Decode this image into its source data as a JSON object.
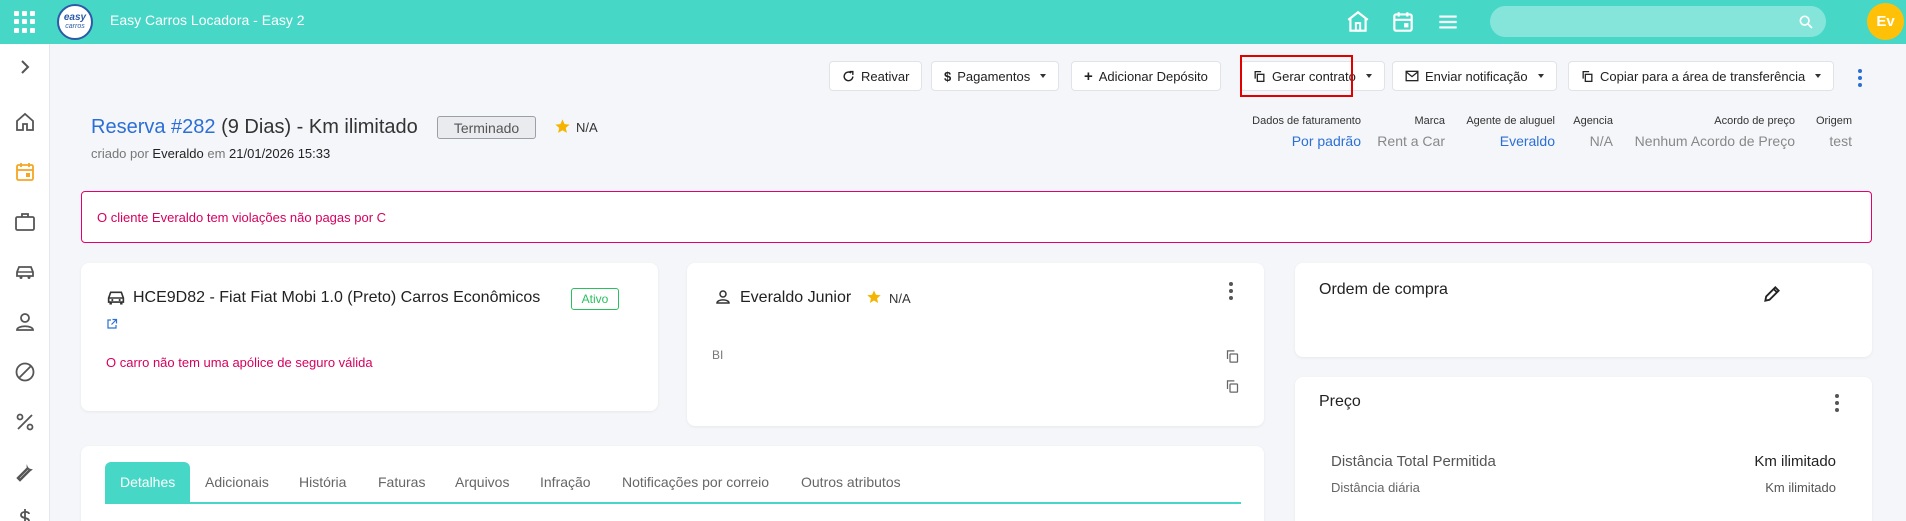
{
  "header": {
    "app_title": "Easy Carros Locadora - Easy 2",
    "logo_line1": "easy",
    "logo_line2": "carros",
    "avatar_initials": "Ev",
    "search_placeholder": ""
  },
  "toolbar": {
    "reactivate": "Reativar",
    "payments": "Pagamentos",
    "add_deposit": "Adicionar Depósito",
    "generate_contract": "Gerar contrato",
    "send_notification": "Enviar notificação",
    "copy_clipboard": "Copiar para a área de transferência"
  },
  "reservation": {
    "title_link": "Reserva #282",
    "title_rest": " (9 Dias) - Km ilimitado",
    "status": "Terminado",
    "rating": "N/A",
    "created_prefix": "criado por ",
    "created_by": "Everaldo",
    "created_mid": " em ",
    "created_at": "21/01/2026 15:33"
  },
  "meta": [
    {
      "label": "Dados de faturamento",
      "value": "Por padrão",
      "link": true
    },
    {
      "label": "Marca",
      "value": "Rent a Car",
      "link": false
    },
    {
      "label": "Agente de aluguel",
      "value": "Everaldo",
      "link": true
    },
    {
      "label": "Agencia",
      "value": "N/A",
      "link": false
    },
    {
      "label": "Acordo de preço",
      "value": "Nenhum Acordo de Preço",
      "link": false
    },
    {
      "label": "Origem",
      "value": "test",
      "link": false
    }
  ],
  "alert": "O cliente Everaldo tem violações não pagas por C",
  "vehicle": {
    "title": "HCE9D82 - Fiat Fiat Mobi 1.0 (Preto) Carros Econômicos",
    "status": "Ativo",
    "warning": "O carro não tem uma apólice de seguro válida"
  },
  "customer": {
    "name": "Everaldo Junior",
    "rating": "N/A",
    "doc_label": "BI"
  },
  "purchase_order": {
    "title": "Ordem de compra"
  },
  "price": {
    "title": "Preço",
    "total_distance_label": "Distância Total Permitida",
    "total_distance_value": "Km ilimitado",
    "daily_distance_label": "Distância diária",
    "daily_distance_value": "Km ilimitado"
  },
  "tabs": [
    "Detalhes",
    "Adicionais",
    "História",
    "Faturas",
    "Arquivos",
    "Infração",
    "Notificações por correio",
    "Outros atributos"
  ],
  "colors": {
    "accent": "#47d7c6",
    "link": "#2b6fd6",
    "danger": "#d6005f",
    "success": "#2bbf5f",
    "sidebar_active": "#f5a623"
  }
}
